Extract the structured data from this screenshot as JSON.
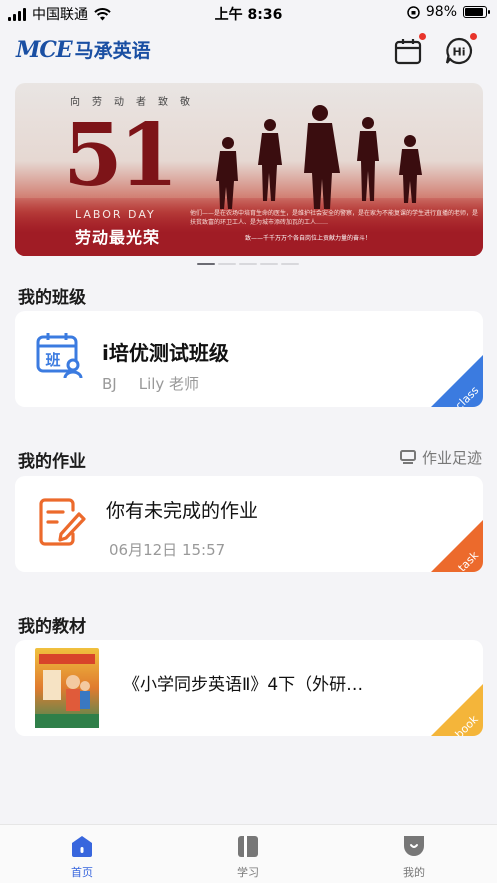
{
  "status_bar": {
    "carrier": "中国联通",
    "time": "上午 8:36",
    "battery": "98%"
  },
  "header": {
    "logo_mark": "MCE",
    "logo_cn": "马承英语",
    "icons": [
      "calendar-icon",
      "hi-message-icon"
    ]
  },
  "banner": {
    "top_text": "向劳动者致敬",
    "big_number": "51",
    "subtitle_en": "LABOR DAY",
    "subtitle_cn": "劳动最光荣",
    "body_text": "他们——是在农场中培育生命的医生，是维护社会安全的警察，是在家为不能复课的学生进行直播的老师，是扶贫致富的环卫工人、是为城市添砖加瓦的工人……",
    "footer_text": "致——千千万万个各自岗位上贡献力量的奋斗！",
    "page_index": 0,
    "page_count": 5
  },
  "my_class": {
    "section_title": "我的班级",
    "icon_label": "班",
    "name": "i培优测试班级",
    "code": "BJ",
    "teacher": "Lily 老师",
    "tag": "class",
    "tag_color": "#3b7be0"
  },
  "my_homework": {
    "section_title": "我的作业",
    "footprint_label": "作业足迹",
    "title": "你有未完成的作业",
    "date": "06月12日 15:57",
    "tag": "task",
    "tag_color": "#ec6a2c"
  },
  "my_textbook": {
    "section_title": "我的教材",
    "title": "《小学同步英语Ⅱ》4下（外研…",
    "tag": "book",
    "tag_color": "#f4b53a"
  },
  "tabbar": {
    "items": [
      {
        "label": "首页",
        "icon": "home-icon",
        "active": true
      },
      {
        "label": "学习",
        "icon": "study-book-icon",
        "active": false
      },
      {
        "label": "我的",
        "icon": "profile-icon",
        "active": false
      }
    ],
    "active_color": "#3866dd"
  }
}
